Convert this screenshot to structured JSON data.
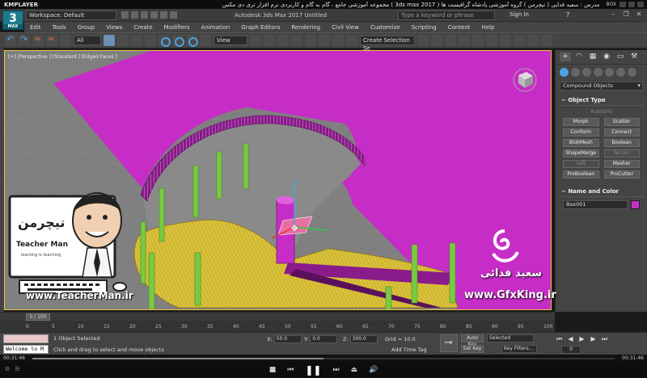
{
  "kmplayer": {
    "logo": "KMPLAYER",
    "title": "مجموعه آموزشی جامع ، گام به گام و کاربردی نرم افزار تری دی مکس ( 3ds max 2017 )   مدرس : سعید فدایی ( تیچرمن ) گروه آموزشی پادشاه گرافیست ها",
    "box_label": "BOX",
    "time_left": "00:31:46",
    "time_right": "00:31:46",
    "progress": 0.5
  },
  "titlebar": {
    "logo_text": "3",
    "logo_sub": "MAX",
    "workspace": "Workspace: Default",
    "app_title": "Autodesk 3ds Max 2017    Untitled",
    "search_placeholder": "Type a keyword or phrase",
    "signin": "Sign In",
    "help": "?"
  },
  "menu": [
    "Edit",
    "Tools",
    "Group",
    "Views",
    "Create",
    "Modifiers",
    "Animation",
    "Graph Editors",
    "Rendering",
    "Civil View",
    "Customize",
    "Scripting",
    "Content",
    "Help"
  ],
  "toolbar": {
    "filter": "All",
    "ref_coord": "View",
    "selection_set": "Create Selection Se"
  },
  "viewport": {
    "label": "[+] [Perspective ] [Standard ] [Edged Faces ]"
  },
  "watermark": {
    "card_title": "Teacher Man",
    "card_sub": "learning & teaching",
    "url": "www.TeacherMan.ir",
    "gfx_name": "سعید فدائی",
    "gfx_url": "www.GfxKing.ir"
  },
  "command_panel": {
    "tabs": [
      "+",
      "◠",
      "▦",
      "◉",
      "▭",
      "⚒"
    ],
    "dropdown": "Compound Objects",
    "object_type_head": "Object Type",
    "autogrid": "AutoGrid",
    "buttons": [
      {
        "label": "Morph",
        "enabled": true
      },
      {
        "label": "Scatter",
        "enabled": true
      },
      {
        "label": "Conform",
        "enabled": true
      },
      {
        "label": "Connect",
        "enabled": true
      },
      {
        "label": "BlobMesh",
        "enabled": true
      },
      {
        "label": "Boolean",
        "enabled": true
      },
      {
        "label": "ShapeMerge",
        "enabled": true
      },
      {
        "label": "Terrain",
        "enabled": false
      },
      {
        "label": "Loft",
        "enabled": false
      },
      {
        "label": "Mesher",
        "enabled": true
      },
      {
        "label": "ProBoolean",
        "enabled": true
      },
      {
        "label": "ProCutter",
        "enabled": true
      }
    ],
    "name_color_head": "Name and Color",
    "object_name": "Box001",
    "object_color": "#c62dc6"
  },
  "timeline": {
    "frame_display": "0 / 100",
    "ticks": [
      "0",
      "5",
      "10",
      "15",
      "20",
      "25",
      "30",
      "35",
      "40",
      "45",
      "50",
      "55",
      "60",
      "65",
      "70",
      "75",
      "80",
      "85",
      "90",
      "95",
      "100"
    ]
  },
  "status": {
    "script_text": "Welcome to M",
    "selection": "1 Object Selected",
    "prompt": "Click and drag to select and move objects",
    "x_label": "X:",
    "x_val": "50.0",
    "y_label": "Y:",
    "y_val": "0.0",
    "z_label": "Z:",
    "z_val": "300.0",
    "grid": "Grid = 10.0",
    "add_time_tag": "Add Time Tag",
    "auto_key": "Auto Key",
    "set_key": "Set Key",
    "selected_dd": "Selected",
    "key_filters": "Key Filters...",
    "frame": "0"
  },
  "colors": {
    "floor_magenta": "#c62dc6",
    "stairs_yellow": "#d9c13a",
    "post_green": "#7ac943",
    "accent_blue": "#4aa3df"
  }
}
